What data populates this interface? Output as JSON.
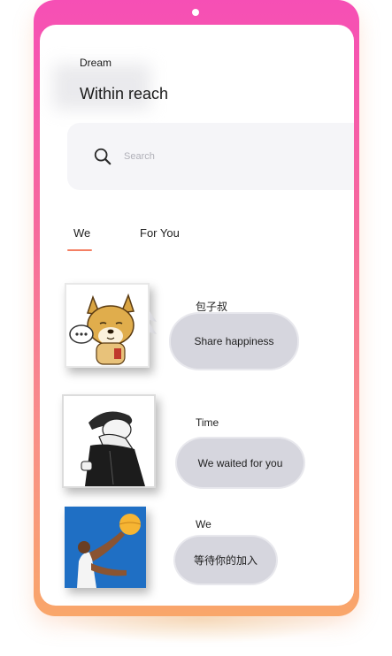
{
  "brand": {
    "small": "Dream",
    "large": "Within reach"
  },
  "search": {
    "placeholder": "Search",
    "icon": "search-icon"
  },
  "tabs": [
    {
      "label": "We",
      "active": true
    },
    {
      "label": "For You",
      "active": false
    }
  ],
  "accent": "#f47f63",
  "frame_gradient": [
    "#f64fb5",
    "#f9a66a"
  ],
  "posts": [
    {
      "name": "包子叔",
      "message": "Share happiness",
      "avatar": "shiba-dog-cartoon"
    },
    {
      "name": "Time",
      "message": "We waited for you",
      "avatar": "hooded-figure-sketch"
    },
    {
      "name": "We",
      "message": "等待你的加入",
      "avatar": "basketball-player"
    }
  ]
}
